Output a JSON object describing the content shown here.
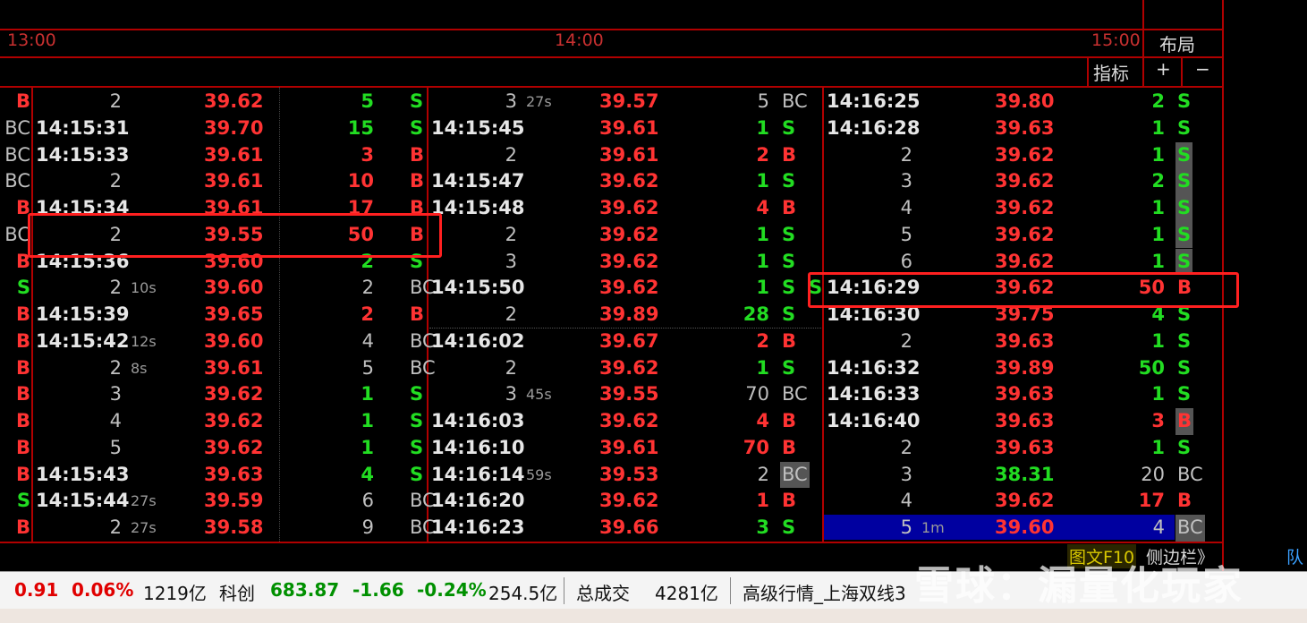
{
  "axis": {
    "labels": [
      "13:00",
      "14:00",
      "15:00"
    ]
  },
  "panel": {
    "layout_label": "布局",
    "indicator_label": "指标",
    "plus": "+",
    "minus": "−"
  },
  "col1": {
    "rows": [
      {
        "pre": "B",
        "time": "2",
        "tag": "",
        "price": "39.62",
        "qty": "5",
        "side": "S"
      },
      {
        "pre": "BC",
        "time": "14:15:31",
        "tag": "",
        "price": "39.70",
        "qty": "15",
        "side": "S"
      },
      {
        "pre": "BC",
        "time": "14:15:33",
        "tag": "",
        "price": "39.61",
        "qty": "3",
        "side": "B"
      },
      {
        "pre": "BC",
        "time": "2",
        "tag": "",
        "price": "39.61",
        "qty": "10",
        "side": "B"
      },
      {
        "pre": "B",
        "time": "14:15:34",
        "tag": "",
        "price": "39.61",
        "qty": "17",
        "side": "B"
      },
      {
        "pre": "BC",
        "time": "2",
        "tag": "",
        "price": "39.55",
        "qty": "50",
        "side": "B"
      },
      {
        "pre": "B",
        "time": "14:15:36",
        "tag": "",
        "price": "39.60",
        "qty": "2",
        "side": "S"
      },
      {
        "pre": "S",
        "time": "2",
        "tag": "10s",
        "price": "39.60",
        "qty": "2",
        "side": "BC"
      },
      {
        "pre": "B",
        "time": "14:15:39",
        "tag": "",
        "price": "39.65",
        "qty": "2",
        "side": "B"
      },
      {
        "pre": "B",
        "time": "14:15:42",
        "tag": "12s",
        "price": "39.60",
        "qty": "4",
        "side": "BC"
      },
      {
        "pre": "B",
        "time": "2",
        "tag": "8s",
        "price": "39.61",
        "qty": "5",
        "side": "BC"
      },
      {
        "pre": "B",
        "time": "3",
        "tag": "",
        "price": "39.62",
        "qty": "1",
        "side": "S"
      },
      {
        "pre": "B",
        "time": "4",
        "tag": "",
        "price": "39.62",
        "qty": "1",
        "side": "S"
      },
      {
        "pre": "B",
        "time": "5",
        "tag": "",
        "price": "39.62",
        "qty": "1",
        "side": "S"
      },
      {
        "pre": "B",
        "time": "14:15:43",
        "tag": "",
        "price": "39.63",
        "qty": "4",
        "side": "S"
      },
      {
        "pre": "S",
        "time": "14:15:44",
        "tag": "27s",
        "price": "39.59",
        "qty": "6",
        "side": "BC"
      },
      {
        "pre": "B",
        "time": "2",
        "tag": "27s",
        "price": "39.58",
        "qty": "9",
        "side": "BC"
      }
    ]
  },
  "col2": {
    "rows": [
      {
        "time": "3",
        "tag": "27s",
        "price": "39.57",
        "qty": "5",
        "side": "BC"
      },
      {
        "time": "14:15:45",
        "tag": "",
        "price": "39.61",
        "qty": "1",
        "side": "S"
      },
      {
        "time": "2",
        "tag": "",
        "price": "39.61",
        "qty": "2",
        "side": "B"
      },
      {
        "time": "14:15:47",
        "tag": "",
        "price": "39.62",
        "qty": "1",
        "side": "S"
      },
      {
        "time": "14:15:48",
        "tag": "",
        "price": "39.62",
        "qty": "4",
        "side": "B"
      },
      {
        "time": "2",
        "tag": "",
        "price": "39.62",
        "qty": "1",
        "side": "S"
      },
      {
        "time": "3",
        "tag": "",
        "price": "39.62",
        "qty": "1",
        "side": "S"
      },
      {
        "time": "14:15:50",
        "tag": "",
        "price": "39.62",
        "qty": "1",
        "side": "S"
      },
      {
        "time": "2",
        "tag": "",
        "price": "39.89",
        "qty": "28",
        "side": "S"
      },
      {
        "time": "14:16:02",
        "tag": "",
        "price": "39.67",
        "qty": "2",
        "side": "B"
      },
      {
        "time": "2",
        "tag": "",
        "price": "39.62",
        "qty": "1",
        "side": "S"
      },
      {
        "time": "3",
        "tag": "45s",
        "price": "39.55",
        "qty": "70",
        "side": "BC"
      },
      {
        "time": "14:16:03",
        "tag": "",
        "price": "39.62",
        "qty": "4",
        "side": "B"
      },
      {
        "time": "14:16:10",
        "tag": "",
        "price": "39.61",
        "qty": "70",
        "side": "B"
      },
      {
        "time": "14:16:14",
        "tag": "59s",
        "price": "39.53",
        "qty": "2",
        "side": "BC"
      },
      {
        "time": "14:16:20",
        "tag": "",
        "price": "39.62",
        "qty": "1",
        "side": "B"
      },
      {
        "time": "14:16:23",
        "tag": "",
        "price": "39.66",
        "qty": "3",
        "side": "S"
      }
    ]
  },
  "col3": {
    "rows": [
      {
        "time": "14:16:25",
        "tag": "",
        "price": "39.80",
        "qty": "2",
        "side": "S"
      },
      {
        "time": "14:16:28",
        "tag": "",
        "price": "39.63",
        "qty": "1",
        "side": "S"
      },
      {
        "time": "2",
        "tag": "",
        "price": "39.62",
        "qty": "1",
        "side": "S"
      },
      {
        "time": "3",
        "tag": "",
        "price": "39.62",
        "qty": "2",
        "side": "S"
      },
      {
        "time": "4",
        "tag": "",
        "price": "39.62",
        "qty": "1",
        "side": "S"
      },
      {
        "time": "5",
        "tag": "",
        "price": "39.62",
        "qty": "1",
        "side": "S"
      },
      {
        "time": "6",
        "tag": "",
        "price": "39.62",
        "qty": "1",
        "side": "S"
      },
      {
        "time": "14:16:29",
        "tag": "",
        "price": "39.62",
        "qty": "50",
        "side": "B"
      },
      {
        "time": "14:16:30",
        "tag": "",
        "price": "39.75",
        "qty": "4",
        "side": "S"
      },
      {
        "time": "2",
        "tag": "",
        "price": "39.63",
        "qty": "1",
        "side": "S"
      },
      {
        "time": "14:16:32",
        "tag": "",
        "price": "39.89",
        "qty": "50",
        "side": "S"
      },
      {
        "time": "14:16:33",
        "tag": "",
        "price": "39.63",
        "qty": "1",
        "side": "S"
      },
      {
        "time": "14:16:40",
        "tag": "",
        "price": "39.63",
        "qty": "3",
        "side": "B"
      },
      {
        "time": "2",
        "tag": "",
        "price": "39.63",
        "qty": "1",
        "side": "S"
      },
      {
        "time": "3",
        "tag": "",
        "price": "38.31",
        "qty": "20",
        "side": "BC"
      },
      {
        "time": "4",
        "tag": "",
        "price": "39.62",
        "qty": "17",
        "side": "B"
      },
      {
        "time": "5",
        "tag": "1m",
        "price": "39.60",
        "qty": "4",
        "side": "BC"
      }
    ],
    "leading_side": "S"
  },
  "side_tabs": {
    "f10": "图文F10",
    "sidebar": "侧边栏》",
    "right_edge": "队"
  },
  "status_bar": {
    "v1": "0.91",
    "v2": "0.06%",
    "v3": "1219亿",
    "kc_label": "科创",
    "kc_index": "683.87",
    "kc_change": "-1.66",
    "kc_pct": "-0.24%",
    "kc_amount": "254.5亿",
    "total_label": "总成交",
    "total_value": "4281亿",
    "feed_label": "高级行情_上海双线3"
  },
  "watermark": "雪球：漏量化玩家",
  "colors": {
    "up": "#ff3333",
    "down": "#22dd22",
    "grid": "#b00000",
    "highlight": "#ff2020"
  }
}
